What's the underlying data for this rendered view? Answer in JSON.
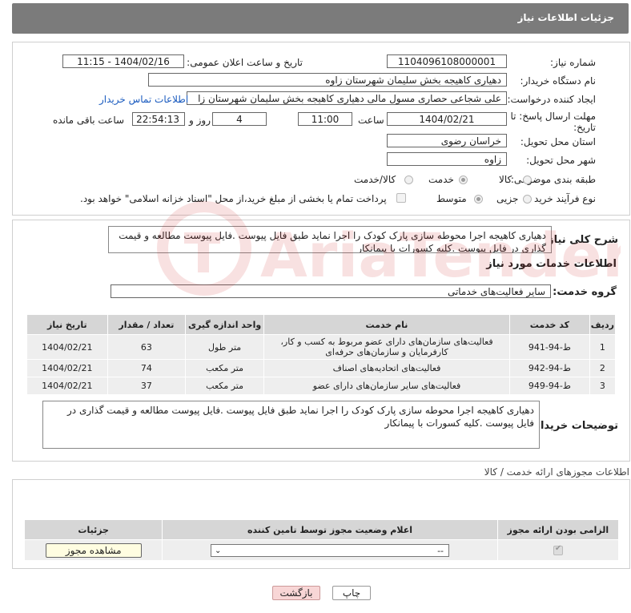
{
  "header": {
    "title": "جزئیات اطلاعات نیاز"
  },
  "need_info": {
    "need_number_label": "شماره نیاز:",
    "need_number": "1104096108000001",
    "announce_label": "تاریخ و ساعت اعلان عمومی:",
    "announce_value": "1404/02/16 - 11:15",
    "buyer_org_label": "نام دستگاه خریدار:",
    "buyer_org": "دهیاری کاهیجه بخش سلیمان شهرستان زاوه",
    "creator_label": "ایجاد کننده درخواست:",
    "creator": "علی شجاعی حصاری مسول مالی دهیاری کاهیجه بخش سلیمان شهرستان زا",
    "contact_link": "اطلاعات تماس خریدار",
    "deadline_label_1": "مهلت ارسال پاسخ: تا",
    "deadline_label_2": "تاریخ:",
    "deadline_date": "1404/02/21",
    "time_label": "ساعت",
    "deadline_time": "11:00",
    "days_value": "4",
    "days_label": "روز و",
    "remaining_time": "22:54:13",
    "remaining_label": "ساعت باقی مانده",
    "province_label": "استان محل تحویل:",
    "province": "خراسان رضوی",
    "city_label": "شهر محل تحویل:",
    "city": "زاوه",
    "category_label": "طبقه بندی موضوعی:",
    "category_options": [
      "کالا",
      "خدمت",
      "کالا/خدمت"
    ],
    "process_label": "نوع فرآیند خرید :",
    "process_options": [
      "جزیی",
      "متوسط"
    ],
    "payment_note": "پرداخت تمام یا بخشی از مبلغ خرید،از محل \"اسناد خزانه اسلامی\" خواهد بود."
  },
  "description": {
    "label": "شرح کلی نیاز:",
    "text": "دهیاری کاهیجه اجرا محوطه سازی پارک کودک را اجرا نماید طبق فایل پیوست .فایل پیوست مطالعه و قیمت گذاری در فایل پیوست .کلیه کسورات با پیمانکار"
  },
  "services": {
    "title": "اطلاعات خدمات مورد نیاز",
    "group_label": "گروه خدمت:",
    "group_value": "سایر فعالیت‌های خدماتی",
    "columns": [
      "ردیف",
      "کد خدمت",
      "نام خدمت",
      "واحد اندازه گیری",
      "تعداد / مقدار",
      "تاریخ نیاز"
    ],
    "rows": [
      {
        "idx": "1",
        "code": "ط-94-941",
        "name": "فعالیت‌های سازمان‌های دارای عضو مربوط به کسب و کار، کارفرمایان و سازمان‌های حرفه‌ای",
        "unit": "متر طول",
        "qty": "63",
        "date": "1404/02/21"
      },
      {
        "idx": "2",
        "code": "ط-94-942",
        "name": "فعالیت‌های اتحادیه‌های اصناف",
        "unit": "متر مکعب",
        "qty": "74",
        "date": "1404/02/21"
      },
      {
        "idx": "3",
        "code": "ط-94-949",
        "name": "فعالیت‌های سایر سازمان‌های دارای عضو",
        "unit": "متر مکعب",
        "qty": "37",
        "date": "1404/02/21"
      }
    ]
  },
  "buyer_notes": {
    "label": "توضیحات خریدار:",
    "text": "دهیاری کاهیجه اجرا محوطه سازی پارک کودک را اجرا نماید طبق فایل پیوست .فایل پیوست مطالعه و قیمت گذاری در فایل پیوست .کلیه کسورات با پیمانکار"
  },
  "permits": {
    "title": "اطلاعات مجوزهای ارائه خدمت / کالا",
    "columns": [
      "الزامی بودن ارائه مجوز",
      "اعلام وضعیت مجوز توسط تامین کننده",
      "جزئیات"
    ],
    "select_value": "--",
    "view_button": "مشاهده مجوز"
  },
  "actions": {
    "print": "چاپ",
    "back": "بازگشت"
  },
  "watermark": "AriaTender.neT"
}
